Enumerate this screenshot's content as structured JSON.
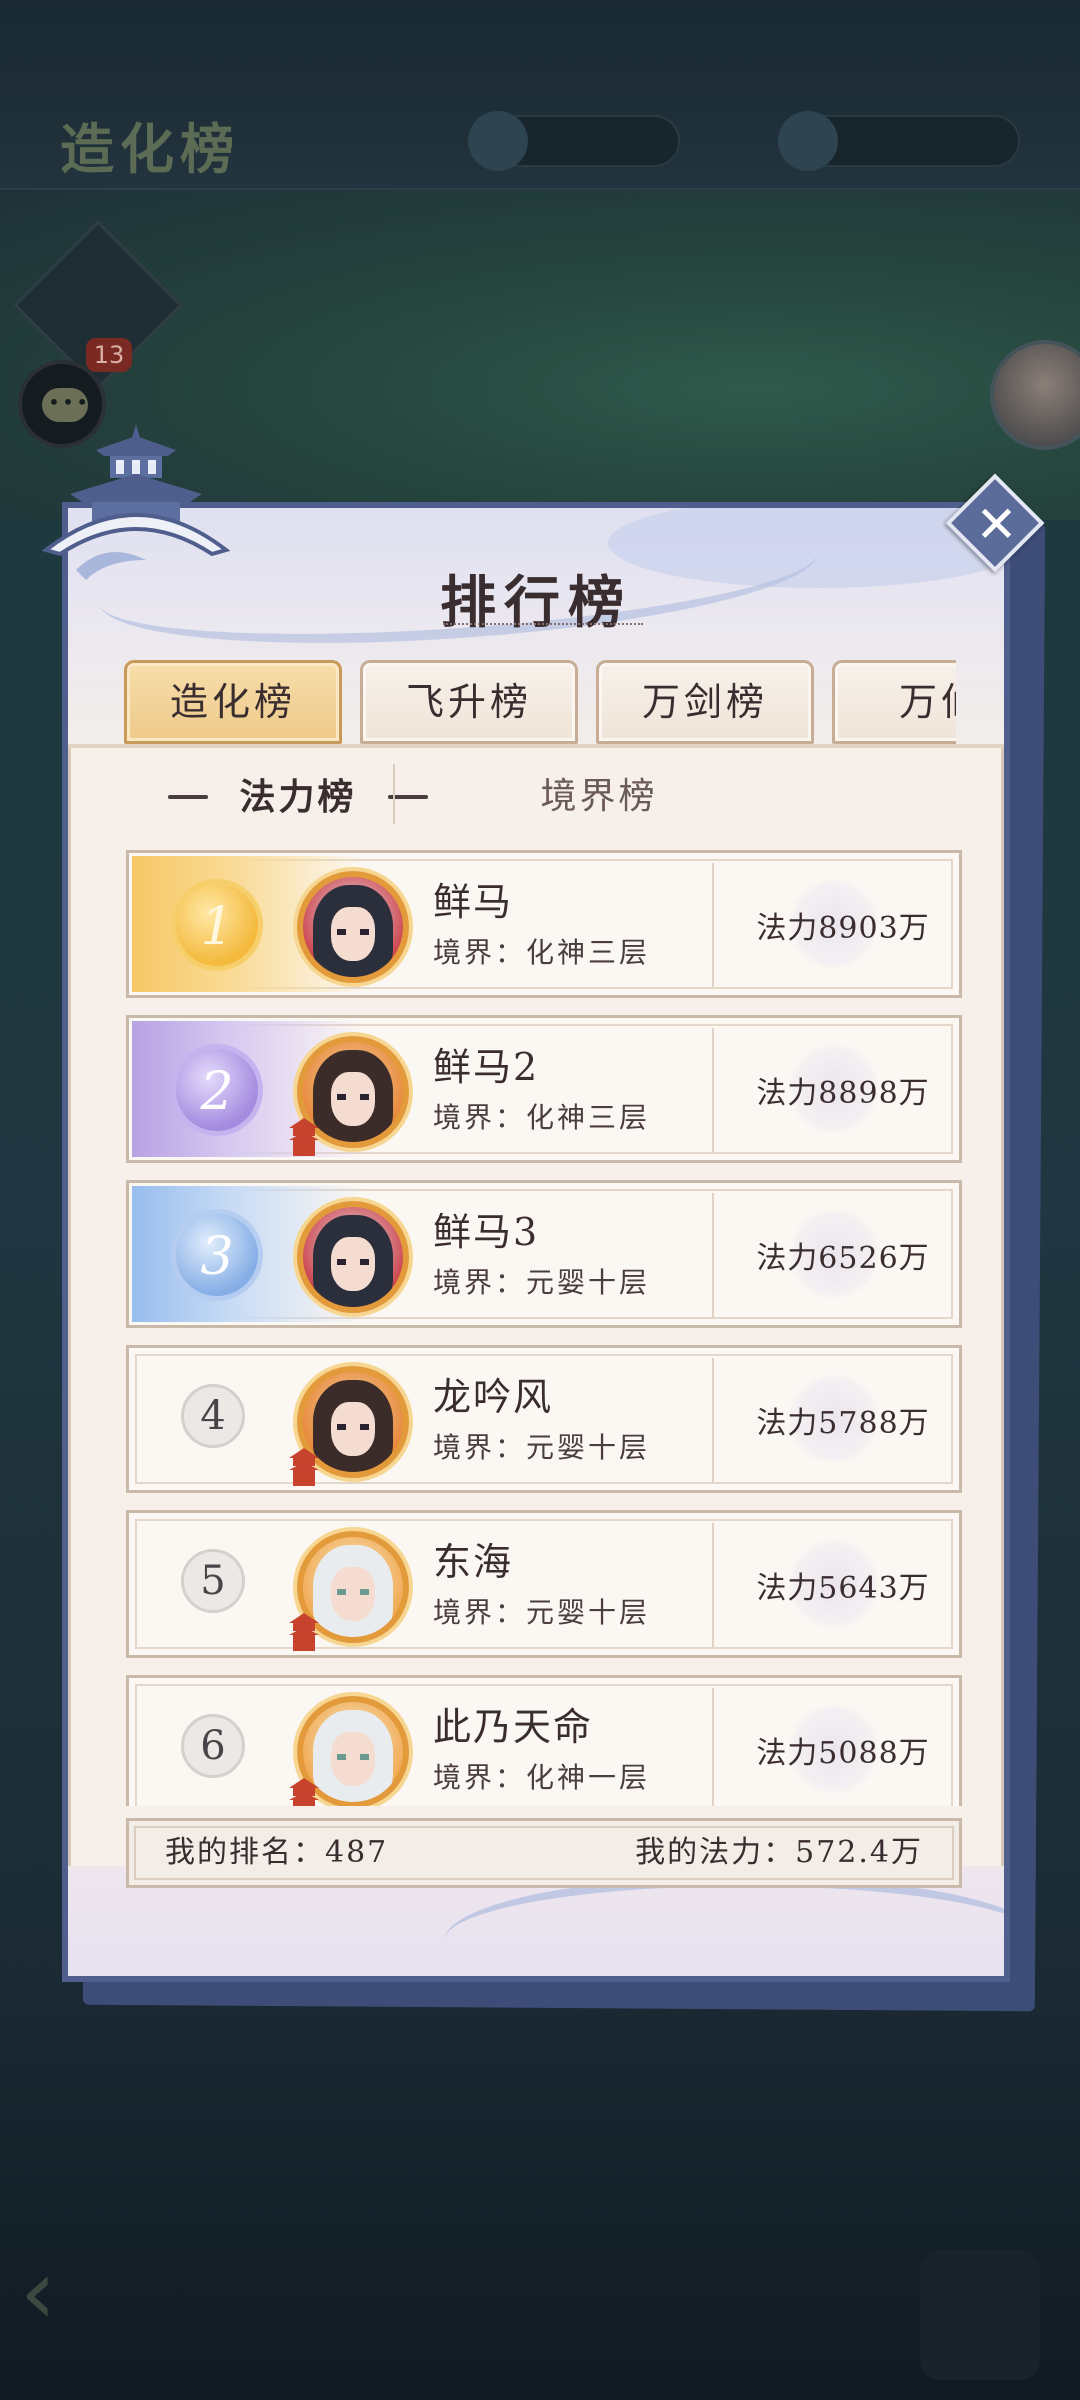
{
  "background": {
    "title": "造化榜",
    "chat_badge": "13"
  },
  "panel": {
    "title": "排行榜",
    "close_label": "✕"
  },
  "tabs": [
    {
      "label": "造化榜",
      "active": true
    },
    {
      "label": "飞升榜",
      "active": false
    },
    {
      "label": "万剑榜",
      "active": false
    },
    {
      "label": "万仙",
      "active": false
    }
  ],
  "subtabs": [
    {
      "label": "法力榜",
      "active": true
    },
    {
      "label": "境界榜",
      "active": false
    }
  ],
  "rows": [
    {
      "rank": "1",
      "name": "鲜马",
      "realm": "境界：化神三层",
      "power": "法力8903万",
      "avatar": "dark"
    },
    {
      "rank": "2",
      "name": "鲜马2",
      "realm": "境界：化神三层",
      "power": "法力8898万",
      "avatar": "brown"
    },
    {
      "rank": "3",
      "name": "鲜马3",
      "realm": "境界：元婴十层",
      "power": "法力6526万",
      "avatar": "dark"
    },
    {
      "rank": "4",
      "name": "龙吟风",
      "realm": "境界：元婴十层",
      "power": "法力5788万",
      "avatar": "brown"
    },
    {
      "rank": "5",
      "name": "东海",
      "realm": "境界：元婴十层",
      "power": "法力5643万",
      "avatar": "white"
    },
    {
      "rank": "6",
      "name": "此乃天命",
      "realm": "境界：化神一层",
      "power": "法力5088万",
      "avatar": "white"
    }
  ],
  "my": {
    "rank_text": "我的排名：487",
    "power_text": "我的法力：572.4万"
  },
  "colors": {
    "panel_border": "#4f5e8c",
    "gold": "#f4b93d",
    "purple": "#a48be0",
    "blue": "#86aee6",
    "tab_active": "#eec98a"
  }
}
